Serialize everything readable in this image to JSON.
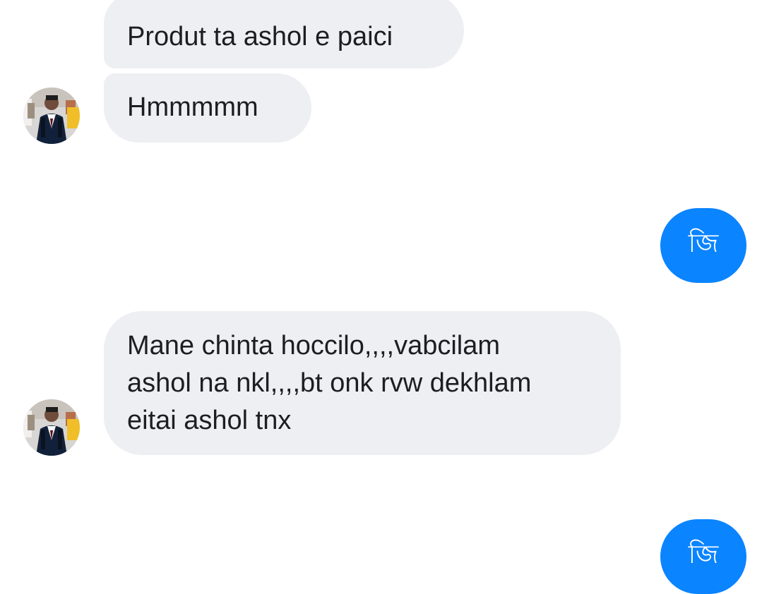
{
  "messages": [
    {
      "direction": "incoming",
      "text": "Produt ta ashol e paici"
    },
    {
      "direction": "incoming",
      "text": "Hmmmmm"
    },
    {
      "direction": "outgoing",
      "text": "জি"
    },
    {
      "direction": "incoming",
      "text": "Mane chinta hoccilo,,,,vabcilam\nashol na nkl,,,,bt onk rvw dekhlam\neitai ashol tnx"
    },
    {
      "direction": "outgoing",
      "text": "জি"
    }
  ],
  "colors": {
    "incoming_bubble": "#eeeff3",
    "outgoing_bubble": "#0b84ff",
    "background": "#ffffff"
  },
  "icons": {
    "avatar": "profile-photo-icon"
  }
}
